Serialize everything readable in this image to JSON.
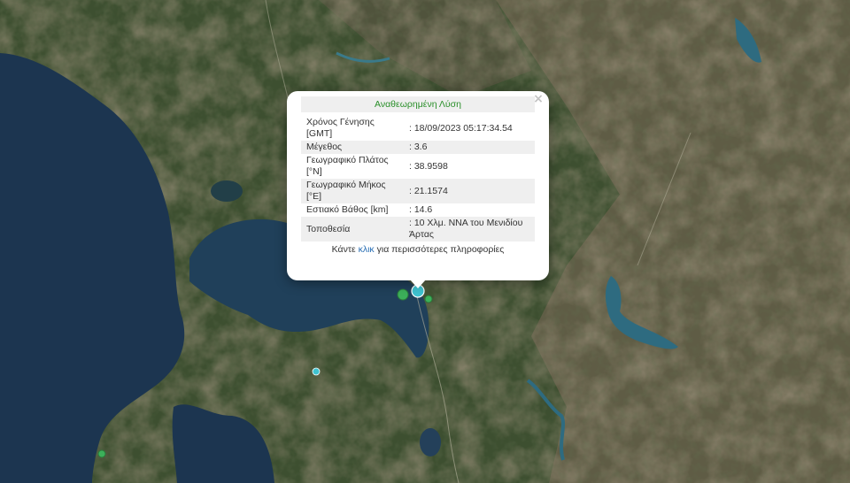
{
  "popup": {
    "title": "Αναθεωρημένη Λύση",
    "close_label": "×",
    "rows": [
      {
        "label": "Χρόνος Γένησης [GMT]",
        "value": ": 18/09/2023 05:17:34.54"
      },
      {
        "label": "Μέγεθος",
        "value": ": 3.6"
      },
      {
        "label": "Γεωγραφικό Πλάτος [°N]",
        "value": ": 38.9598"
      },
      {
        "label": "Γεωγραφικό Μήκος [°E]",
        "value": ": 21.1574"
      },
      {
        "label": "Εστιακό Βάθος [km]",
        "value": ": 14.6"
      },
      {
        "label": "Τοποθεσία",
        "value": ": 10 Χλμ. ΝΝΑ του Μενιδίου Άρτας"
      }
    ],
    "more_prefix": "Κάντε ",
    "more_link": "κλικ",
    "more_suffix": " για περισσότερες πληροφορίες"
  },
  "colors": {
    "sea": "#1c3550",
    "land": "#3d4f30",
    "mountains": "#6b604c",
    "marker_cyan": "#3fc3d0",
    "marker_green": "#3cb05a",
    "popup_title": "#2a8f2a",
    "link": "#2a6fb5"
  }
}
